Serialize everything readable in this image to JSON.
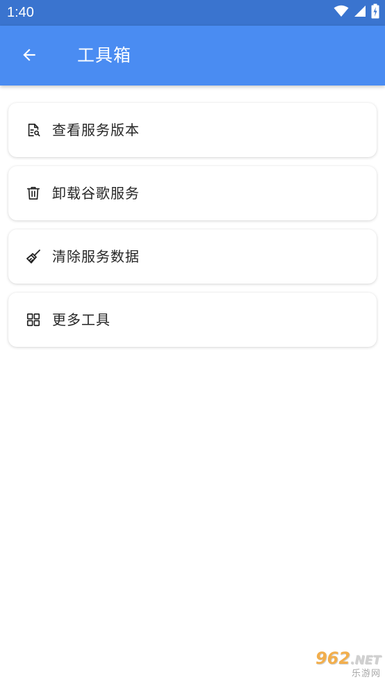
{
  "status_bar": {
    "time": "1:40",
    "icons": [
      "wifi-icon",
      "signal-icon",
      "battery-charging-icon"
    ]
  },
  "app_bar": {
    "back_icon": "arrow-back-icon",
    "title": "工具箱"
  },
  "tools": [
    {
      "icon": "document-search-icon",
      "label": "查看服务版本"
    },
    {
      "icon": "trash-icon",
      "label": "卸载谷歌服务"
    },
    {
      "icon": "broom-icon",
      "label": "清除服务数据"
    },
    {
      "icon": "grid-icon",
      "label": "更多工具"
    }
  ],
  "watermark": {
    "number": "962",
    "domain": ".NET",
    "text": "乐游网"
  },
  "colors": {
    "status_bar": "#3a74cf",
    "app_bar": "#4a8cf2",
    "text": "#262626",
    "background": "#ffffff"
  }
}
